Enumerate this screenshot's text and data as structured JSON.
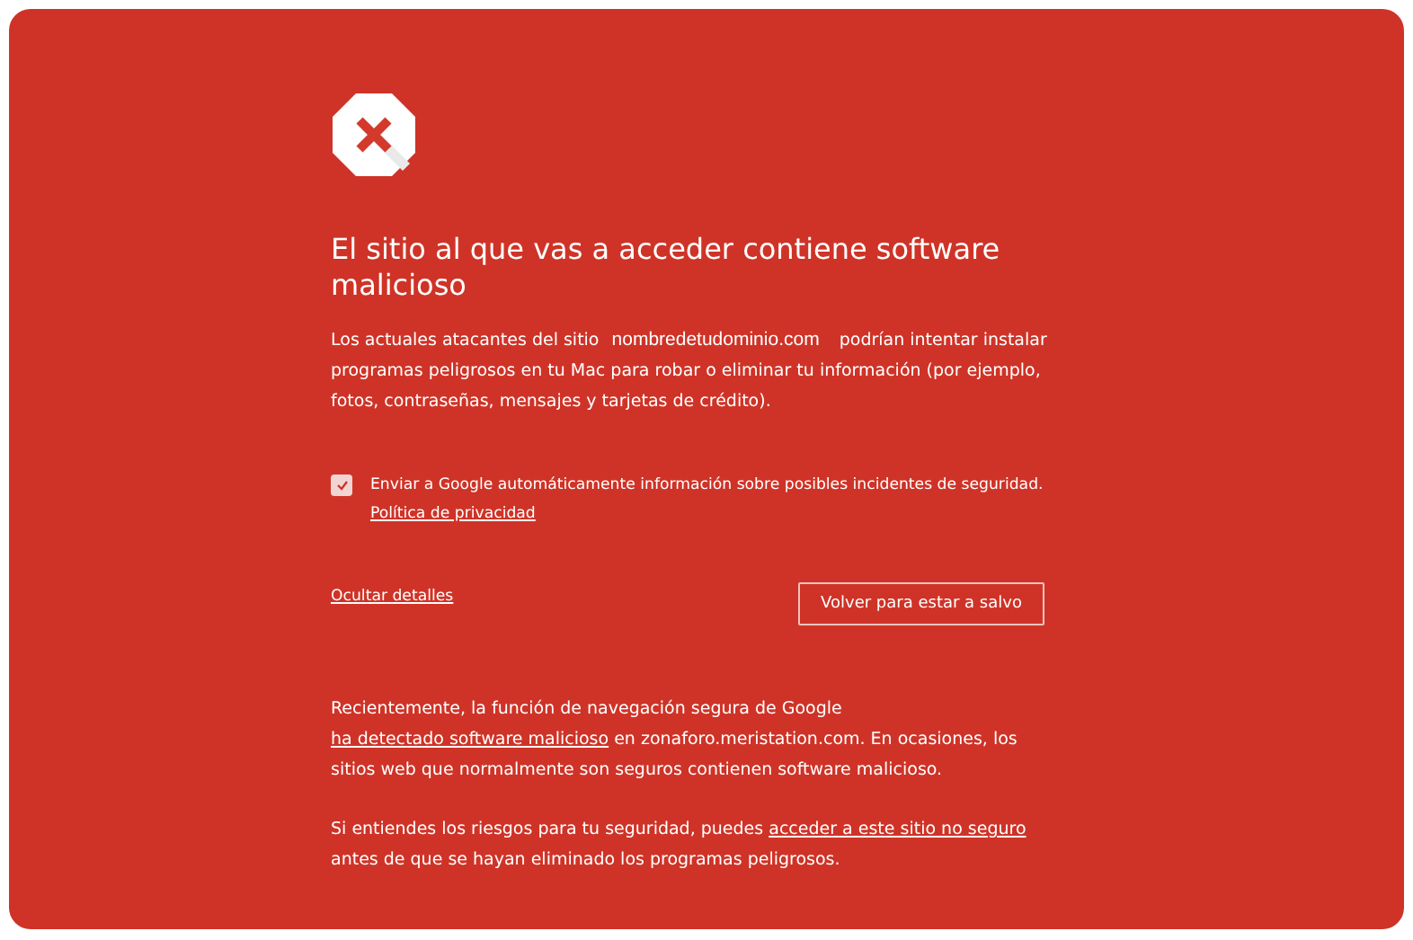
{
  "heading": "El sitio al que vas a acceder contiene software malicioso",
  "intro": [
    {
      "kind": "text",
      "text": "Los actuales atacantes del sitio "
    },
    {
      "kind": "domain",
      "text": "nombredetudominio.com"
    },
    {
      "kind": "text",
      "text": " podrían intentar instalar programas peligrosos en tu Mac para robar o eliminar tu información (por ejemplo, fotos, contraseñas, mensajes y tarjetas de crédito)."
    }
  ],
  "report": {
    "checked": true,
    "label": "Enviar a Google automáticamente información sobre posibles incidentes de seguridad.",
    "privacy_link": "Política de privacidad"
  },
  "details_link": "Ocultar detalles",
  "back_button": "Volver para estar a salvo",
  "details": [
    [
      {
        "kind": "text",
        "text": "Recientemente, la función de navegación segura de Google "
      },
      {
        "kind": "link",
        "text": "ha detectado software malicioso"
      },
      {
        "kind": "text",
        "text": " en zonaforo.meristation.com. En ocasiones, los sitios web que normalmente son seguros contienen software malicioso."
      }
    ],
    [
      {
        "kind": "text",
        "text": "Si entiendes los riesgos para tu seguridad, puedes "
      },
      {
        "kind": "link",
        "text": "acceder a este sitio no seguro"
      },
      {
        "kind": "text",
        "text": " antes de que se hayan eliminado los programas peligrosos."
      }
    ]
  ]
}
